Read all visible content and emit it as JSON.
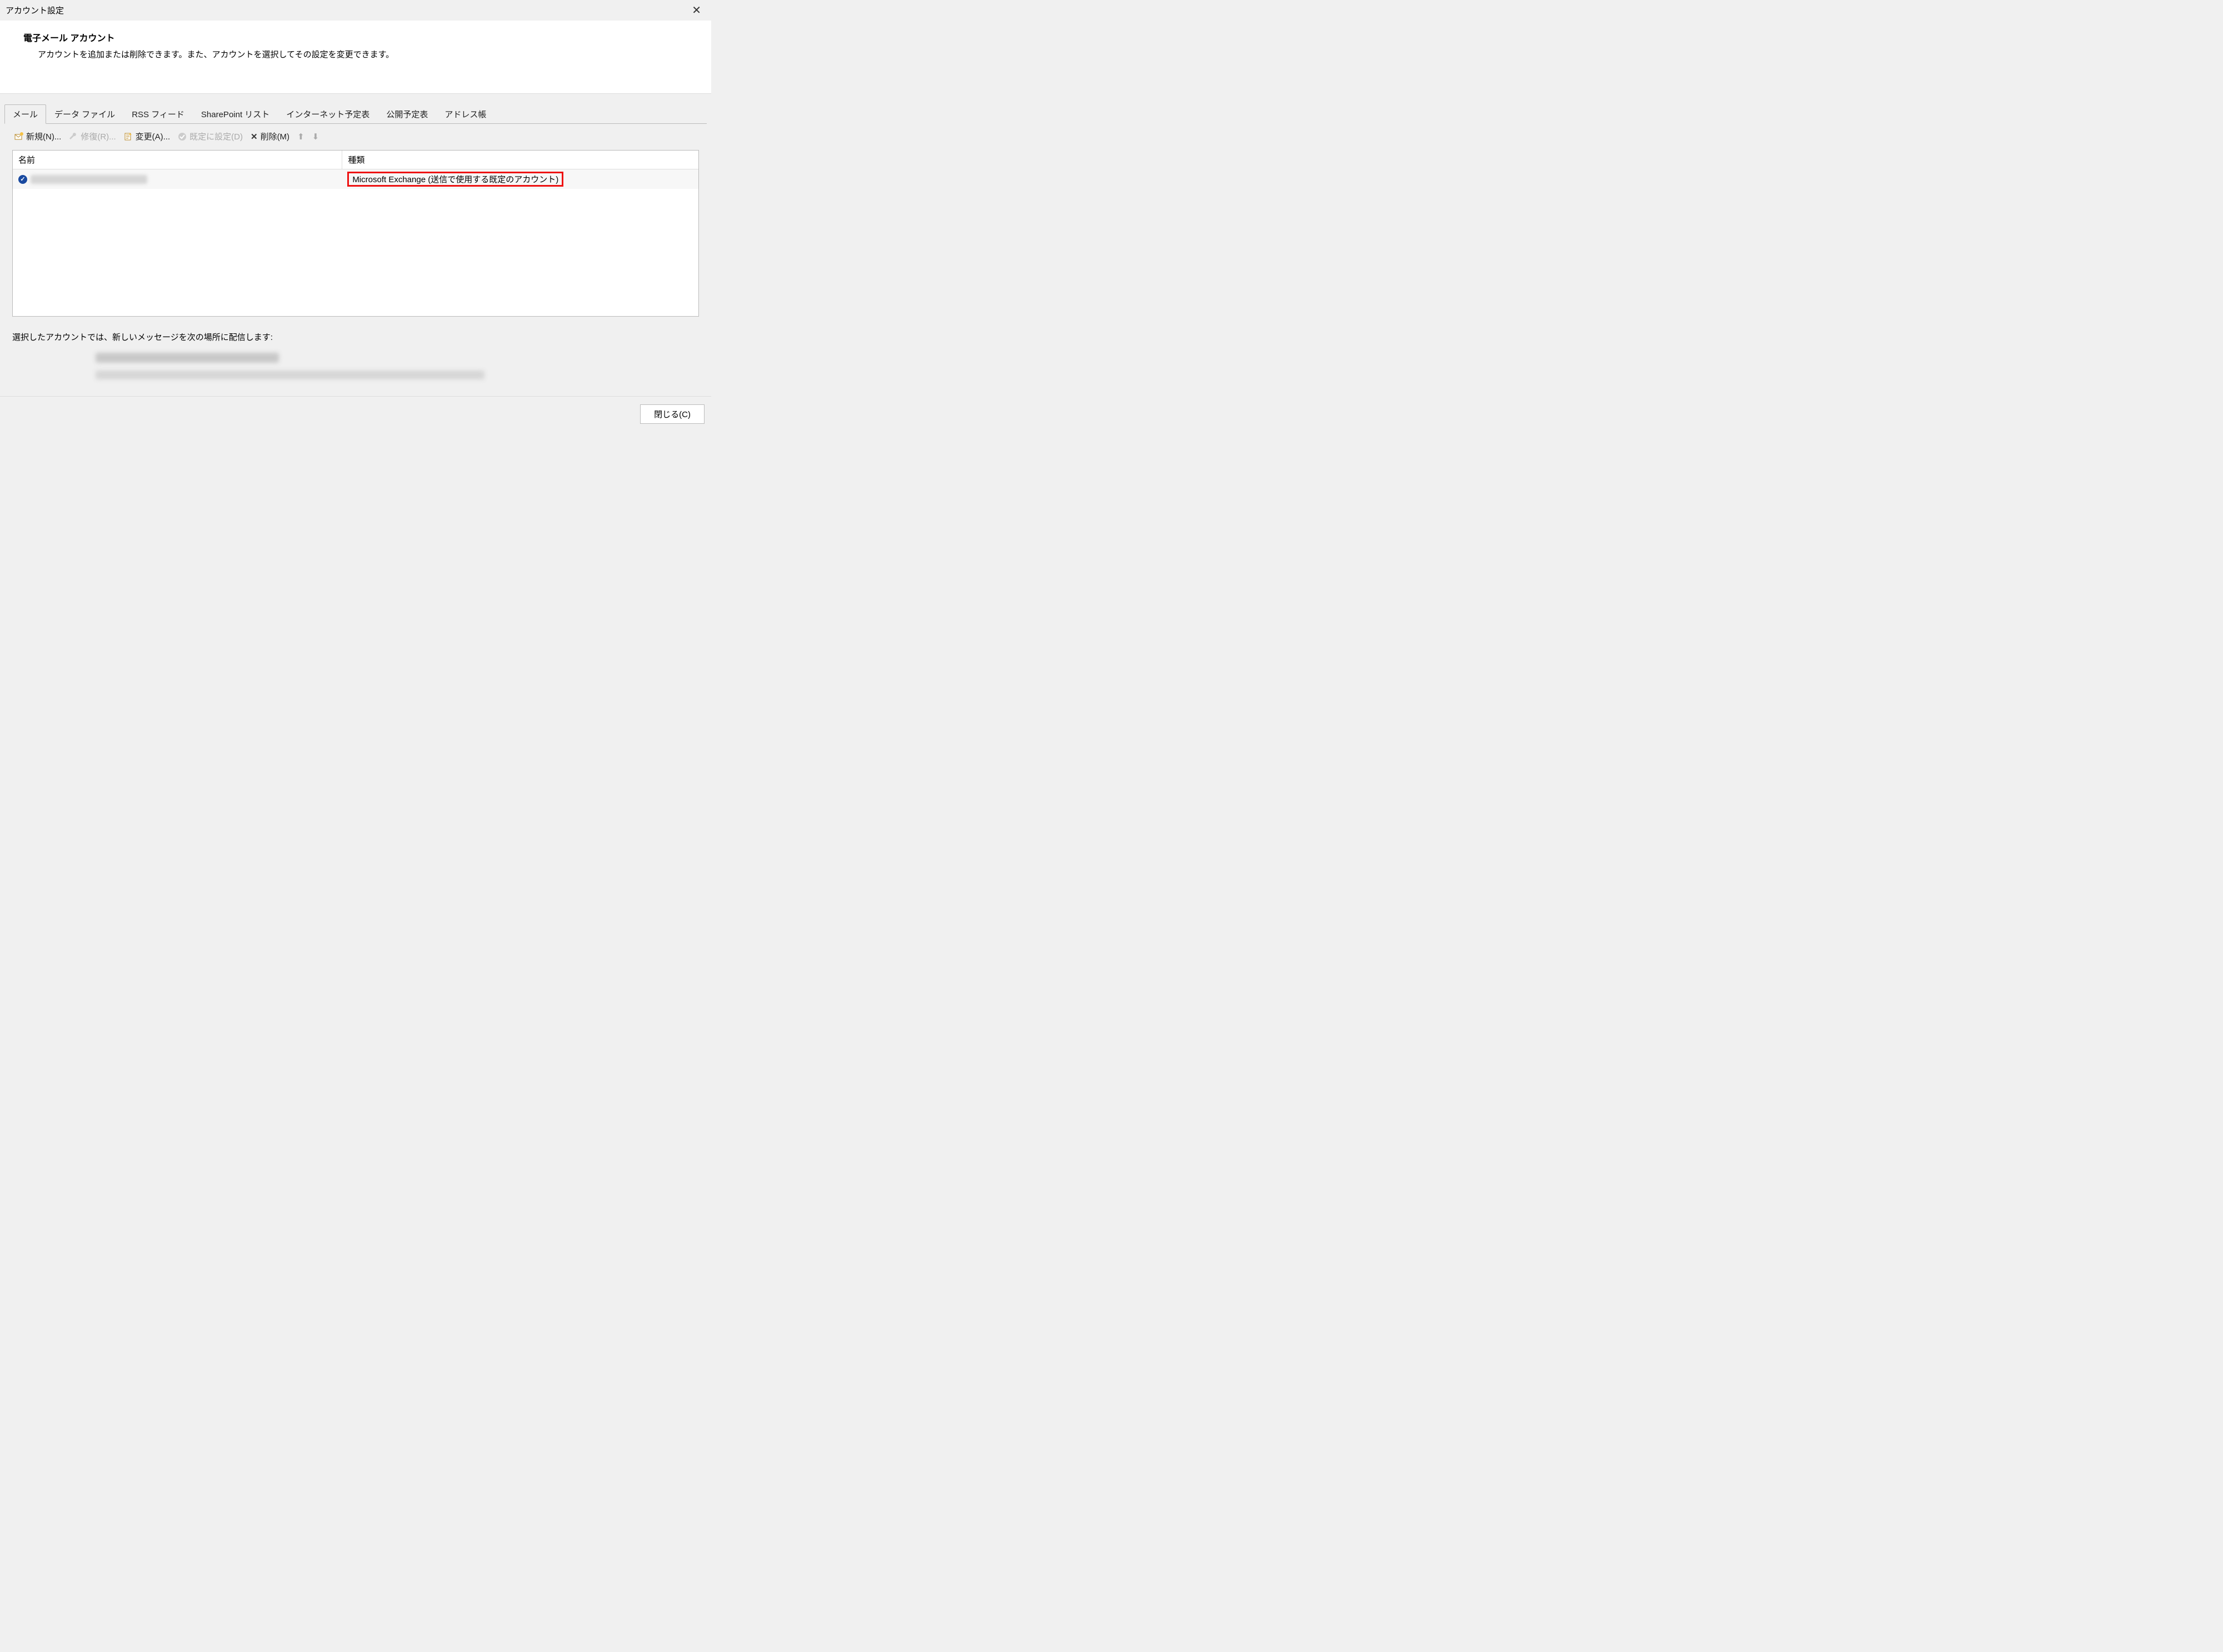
{
  "window": {
    "title": "アカウント設定"
  },
  "intro": {
    "heading": "電子メール アカウント",
    "description": "アカウントを追加または削除できます。また、アカウントを選択してその設定を変更できます。"
  },
  "tabs": {
    "mail": "メール",
    "datafiles": "データ ファイル",
    "rss": "RSS フィード",
    "sharepoint": "SharePoint リスト",
    "internet_cal": "インターネット予定表",
    "published_cal": "公開予定表",
    "address_book": "アドレス帳"
  },
  "toolbar": {
    "new": "新規(N)...",
    "repair": "修復(R)...",
    "change": "変更(A)...",
    "set_default": "既定に設定(D)",
    "delete": "削除(M)"
  },
  "list": {
    "header": {
      "name": "名前",
      "type": "種類"
    },
    "rows": [
      {
        "type_text": "Microsoft Exchange (送信で使用する既定のアカウント)"
      }
    ]
  },
  "delivery": {
    "label": "選択したアカウントでは、新しいメッセージを次の場所に配信します:"
  },
  "footer": {
    "close": "閉じる(C)"
  },
  "colors": {
    "highlight_border": "#e11111"
  }
}
